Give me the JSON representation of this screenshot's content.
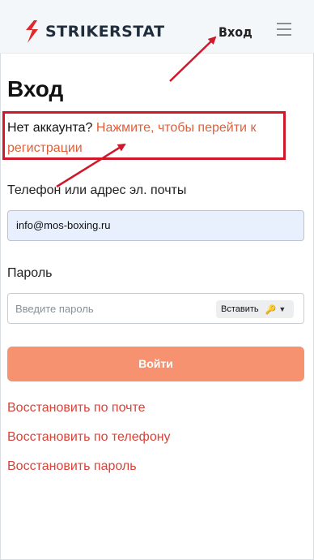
{
  "header": {
    "brand": "STRIKERSTAT",
    "nav_login": "Вход",
    "menu_icon": "hamburger-icon",
    "logo_icon": "strikerstat-logo-icon"
  },
  "main": {
    "title": "Вход",
    "no_account_text": "Нет аккаунта?",
    "register_link": "Нажмите, чтобы перейти к регистрации",
    "phone_label": "Телефон или адрес эл. почты",
    "email_value": "info@mos-boxing.ru",
    "password_label": "Пароль",
    "password_placeholder": "Введите пароль",
    "paste_label": "Вставить",
    "submit_label": "Войти",
    "recover_mail": "Восстановить по почте",
    "recover_phone": "Восстановить по телефону",
    "recover_password": "Восстановить пароль"
  },
  "colors": {
    "accent": "#e0603a",
    "button": "#f6926f",
    "annotation": "#d0182b",
    "recover_link": "#d8433a"
  }
}
